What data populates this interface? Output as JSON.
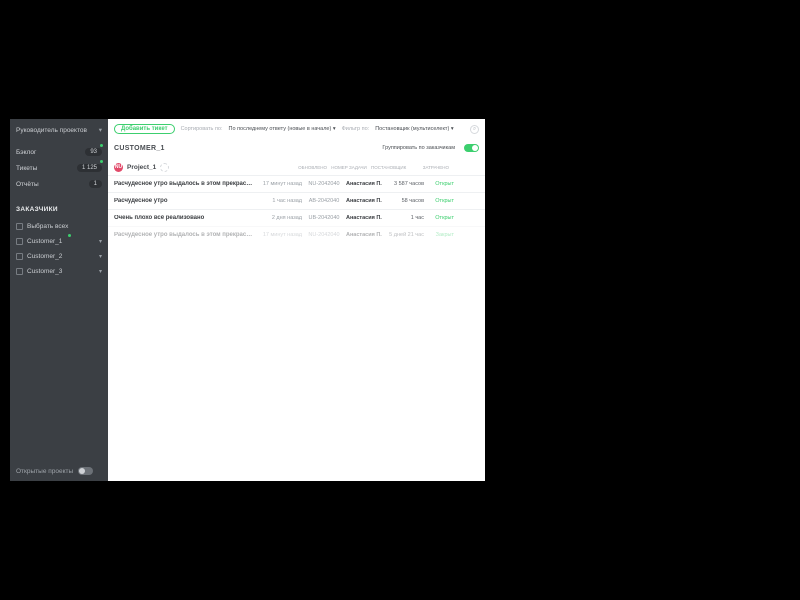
{
  "sidebar": {
    "role": "Руководитель проектов",
    "nav": [
      {
        "label": "Бэклог",
        "count": "93",
        "dot": true
      },
      {
        "label": "Тикеты",
        "count": "1 125",
        "dot": true
      },
      {
        "label": "Отчёты",
        "count": "1",
        "dot": false
      }
    ],
    "customers_header": "ЗАКАЗЧИКИ",
    "select_all": "Выбрать всех",
    "customers": [
      {
        "label": "Customer_1",
        "dot": true
      },
      {
        "label": "Customer_2"
      },
      {
        "label": "Customer_3"
      }
    ],
    "open_projects": "Открытые проекты"
  },
  "topbar": {
    "add": "Добавить тикет",
    "sort_label": "Сортировать по:",
    "sort_value": "По последнему ответу (новые в начале)",
    "filter_label": "Фильтр по:",
    "filter_value": "Постановщик (мультиселект)"
  },
  "header": {
    "customer": "CUSTOMER_1",
    "group_label": "Группировать по заказчикам"
  },
  "project": {
    "badge": "NU",
    "name": "Project_1",
    "cols": [
      "ОБНОВЛЕНО",
      "НОМЕР ЗАДАЧИ",
      "ПОСТАНОВЩИК",
      "ЗАТРАЧЕНО",
      ""
    ]
  },
  "rows": [
    {
      "title": "Расчудесное утро выдалось в этом прекрасно...",
      "upd": "17 минут назад",
      "id": "NU-2042040",
      "own": "Анастасия П.",
      "tim": "3 587 часов",
      "st": "Открыт"
    },
    {
      "title": "Расчудесное утро",
      "upd": "1 час назад",
      "id": "AB-2042040",
      "own": "Анастасия П.",
      "tim": "58 часов",
      "st": "Открыт"
    },
    {
      "title": "Очень плохо всё реализовано",
      "upd": "2 дня назад",
      "id": "UB-2042040",
      "own": "Анастасия П.",
      "tim": "1 час",
      "st": "Открыт"
    },
    {
      "title": "Расчудесное утро выдалось в этом прекрасно...",
      "upd": "17 минут назад",
      "id": "NU-2042040",
      "own": "Анастасия П.",
      "tim": "5 дней 21 час",
      "st": "Закрыт",
      "faded": true
    }
  ]
}
